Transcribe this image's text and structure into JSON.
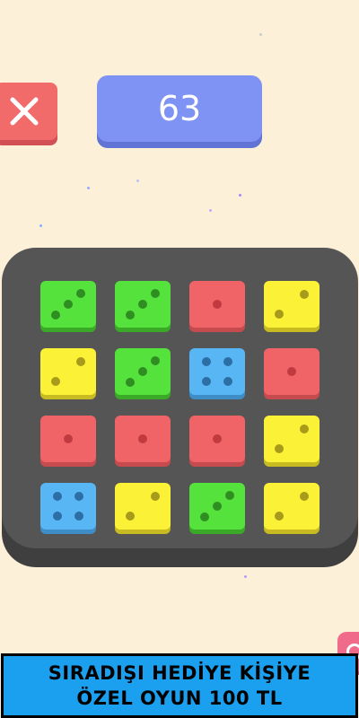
{
  "game": {
    "score": "63",
    "colors": {
      "background": "#fdf0d8",
      "board": "#555555",
      "close_button": "#f26b6b",
      "score_panel": "#7f93f5",
      "green": "#56e23c",
      "red": "#f06467",
      "yellow": "#fbf237",
      "blue": "#59b6f5"
    },
    "board": {
      "rows": [
        [
          {
            "color": "green",
            "pips": 3
          },
          {
            "color": "green",
            "pips": 3
          },
          {
            "color": "red",
            "pips": 1
          },
          {
            "color": "yellow",
            "pips": 2
          }
        ],
        [
          {
            "color": "yellow",
            "pips": 2
          },
          {
            "color": "green",
            "pips": 3
          },
          {
            "color": "blue",
            "pips": 4
          },
          {
            "color": "red",
            "pips": 1
          }
        ],
        [
          {
            "color": "red",
            "pips": 1
          },
          {
            "color": "red",
            "pips": 1
          },
          {
            "color": "red",
            "pips": 1
          },
          {
            "color": "yellow",
            "pips": 2
          }
        ],
        [
          {
            "color": "blue",
            "pips": 4
          },
          {
            "color": "yellow",
            "pips": 2
          },
          {
            "color": "green",
            "pips": 3
          },
          {
            "color": "yellow",
            "pips": 2
          }
        ]
      ]
    }
  },
  "ad_banner": {
    "line1": "SIRADIŞI HEDİYE KİŞİYE",
    "line2": "ÖZEL OYUN 100 TL"
  },
  "icons": {
    "close": "close-icon",
    "side_button": "ring-icon"
  }
}
